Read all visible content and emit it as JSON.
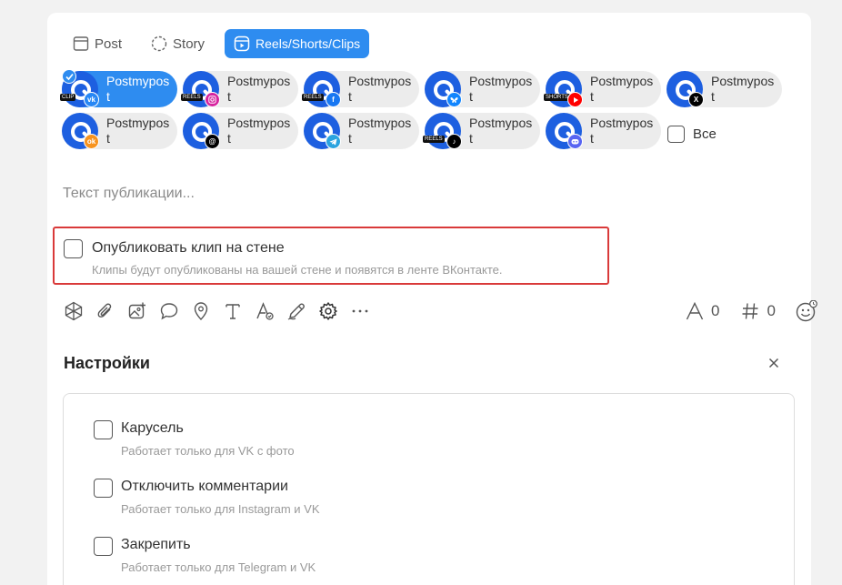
{
  "tabs": [
    {
      "label": "Post",
      "icon": "post-icon",
      "active": false
    },
    {
      "label": "Story",
      "icon": "story-icon",
      "active": false
    },
    {
      "label": "Reels/Shorts/Clips",
      "icon": "reels-icon",
      "active": true
    }
  ],
  "accounts": [
    {
      "name": "Postmypost",
      "network": "vk-icon",
      "tag": "CLIP",
      "selected": true,
      "color": "#2787f5"
    },
    {
      "name": "Postmypost",
      "network": "instagram-icon",
      "tag": "REELS",
      "selected": false,
      "color": "#d6249f"
    },
    {
      "name": "Postmypost",
      "network": "facebook-icon",
      "tag": "REELS",
      "selected": false,
      "color": "#1877f2"
    },
    {
      "name": "Postmypost",
      "network": "bluesky-icon",
      "tag": "",
      "selected": false,
      "color": "#1185fe"
    },
    {
      "name": "Postmypost",
      "network": "youtube-icon",
      "tag": "SHORTS",
      "selected": false,
      "color": "#ff0000"
    },
    {
      "name": "Postmypost",
      "network": "x-icon",
      "tag": "",
      "selected": false,
      "color": "#000000"
    },
    {
      "name": "Postmypost",
      "network": "odnoklassniki-icon",
      "tag": "",
      "selected": false,
      "color": "#f7931e"
    },
    {
      "name": "Postmypost",
      "network": "threads-icon",
      "tag": "",
      "selected": false,
      "color": "#000000"
    },
    {
      "name": "Postmypost",
      "network": "telegram-icon",
      "tag": "",
      "selected": false,
      "color": "#2aa3df"
    },
    {
      "name": "Postmypost",
      "network": "tiktok-icon",
      "tag": "REELS",
      "selected": false,
      "color": "#000000"
    },
    {
      "name": "Postmypost",
      "network": "discord-icon",
      "tag": "",
      "selected": false,
      "color": "#5865f2"
    }
  ],
  "select_all_label": "Все",
  "text_placeholder": "Текст публикации...",
  "vk_wall": {
    "label": "Опубликовать клип на стене",
    "description": "Клипы будут опубликованы на вашей стене и появятся в ленте ВКонтакте."
  },
  "toolbar_icons": [
    "ai-icon",
    "paperclip-icon",
    "add-image-icon",
    "comment-icon",
    "location-icon",
    "text-format-icon",
    "font-style-icon",
    "pen-icon",
    "gear-icon",
    "more-icon"
  ],
  "counters": {
    "chars": "0",
    "hashtags": "0"
  },
  "settings": {
    "title": "Настройки",
    "options": [
      {
        "label": "Карусель",
        "description": "Работает только для VK с фото"
      },
      {
        "label": "Отключить комментарии",
        "description": "Работает только для Instagram и VK"
      },
      {
        "label": "Закрепить",
        "description": "Работает только для Telegram и VK"
      }
    ]
  },
  "colors": {
    "accent": "#2e8cf0",
    "avatar": "#1d5fe0",
    "highlight_border": "#d93a3a"
  }
}
